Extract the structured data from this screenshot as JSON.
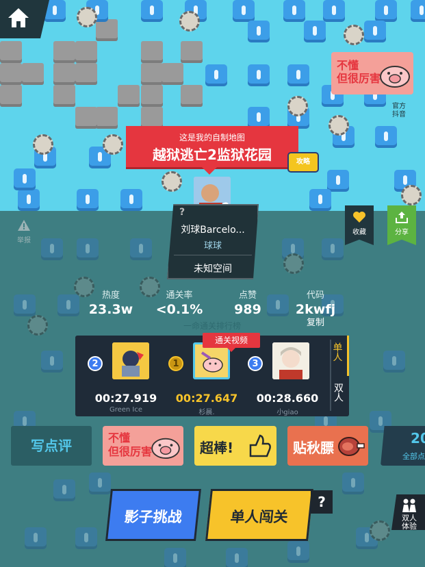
{
  "nav": {
    "home_icon": "home-icon"
  },
  "map": {
    "banner_subtitle": "这是我的自制地图",
    "banner_title": "越狱逃亡2监狱花园",
    "guide_tv_label": "攻略"
  },
  "creator": {
    "question": "?",
    "name": "刘球Barcelo...",
    "tag": "球球",
    "space_label": "未知空间"
  },
  "report": {
    "label": "举报"
  },
  "side": {
    "official_label": "官方\n抖音",
    "collect_label": "收藏",
    "share_label": "分享"
  },
  "stats": [
    {
      "label": "热度",
      "value": "23.3w"
    },
    {
      "label": "通关率",
      "value": "<0.1%"
    },
    {
      "label": "点赞",
      "value": "989"
    },
    {
      "label": "代码",
      "value": "2kwfj"
    }
  ],
  "copy_label": "复制",
  "leaderboard": {
    "header": "一命通关排行榜",
    "video_badge": "通关视频",
    "tabs": [
      "单人",
      "双人"
    ],
    "active_tab": "单人",
    "entries": [
      {
        "rank": "2",
        "time": "00:27.919",
        "name": "Green Ice"
      },
      {
        "rank": "1",
        "time": "00:27.647",
        "name": "杉晨."
      },
      {
        "rank": "3",
        "time": "00:28.660",
        "name": "小giao"
      }
    ]
  },
  "comments": {
    "write_label": "写点评",
    "stickers": [
      {
        "text": "不懂\n但很厉害"
      },
      {
        "text": "超棒!"
      },
      {
        "text": "贴秋膘"
      }
    ],
    "corner_sticker": "不懂\n但很厉害",
    "count": "20",
    "count_label": "全部点"
  },
  "actions": {
    "shadow_label": "影子挑战",
    "single_label": "单人闯关",
    "help": "?",
    "duo_label": "双人\n体验"
  },
  "colors": {
    "accent_red": "#e5363f",
    "accent_yellow": "#f7c32a",
    "accent_blue": "#3d7cf0",
    "text_blue": "#53c7ea"
  }
}
